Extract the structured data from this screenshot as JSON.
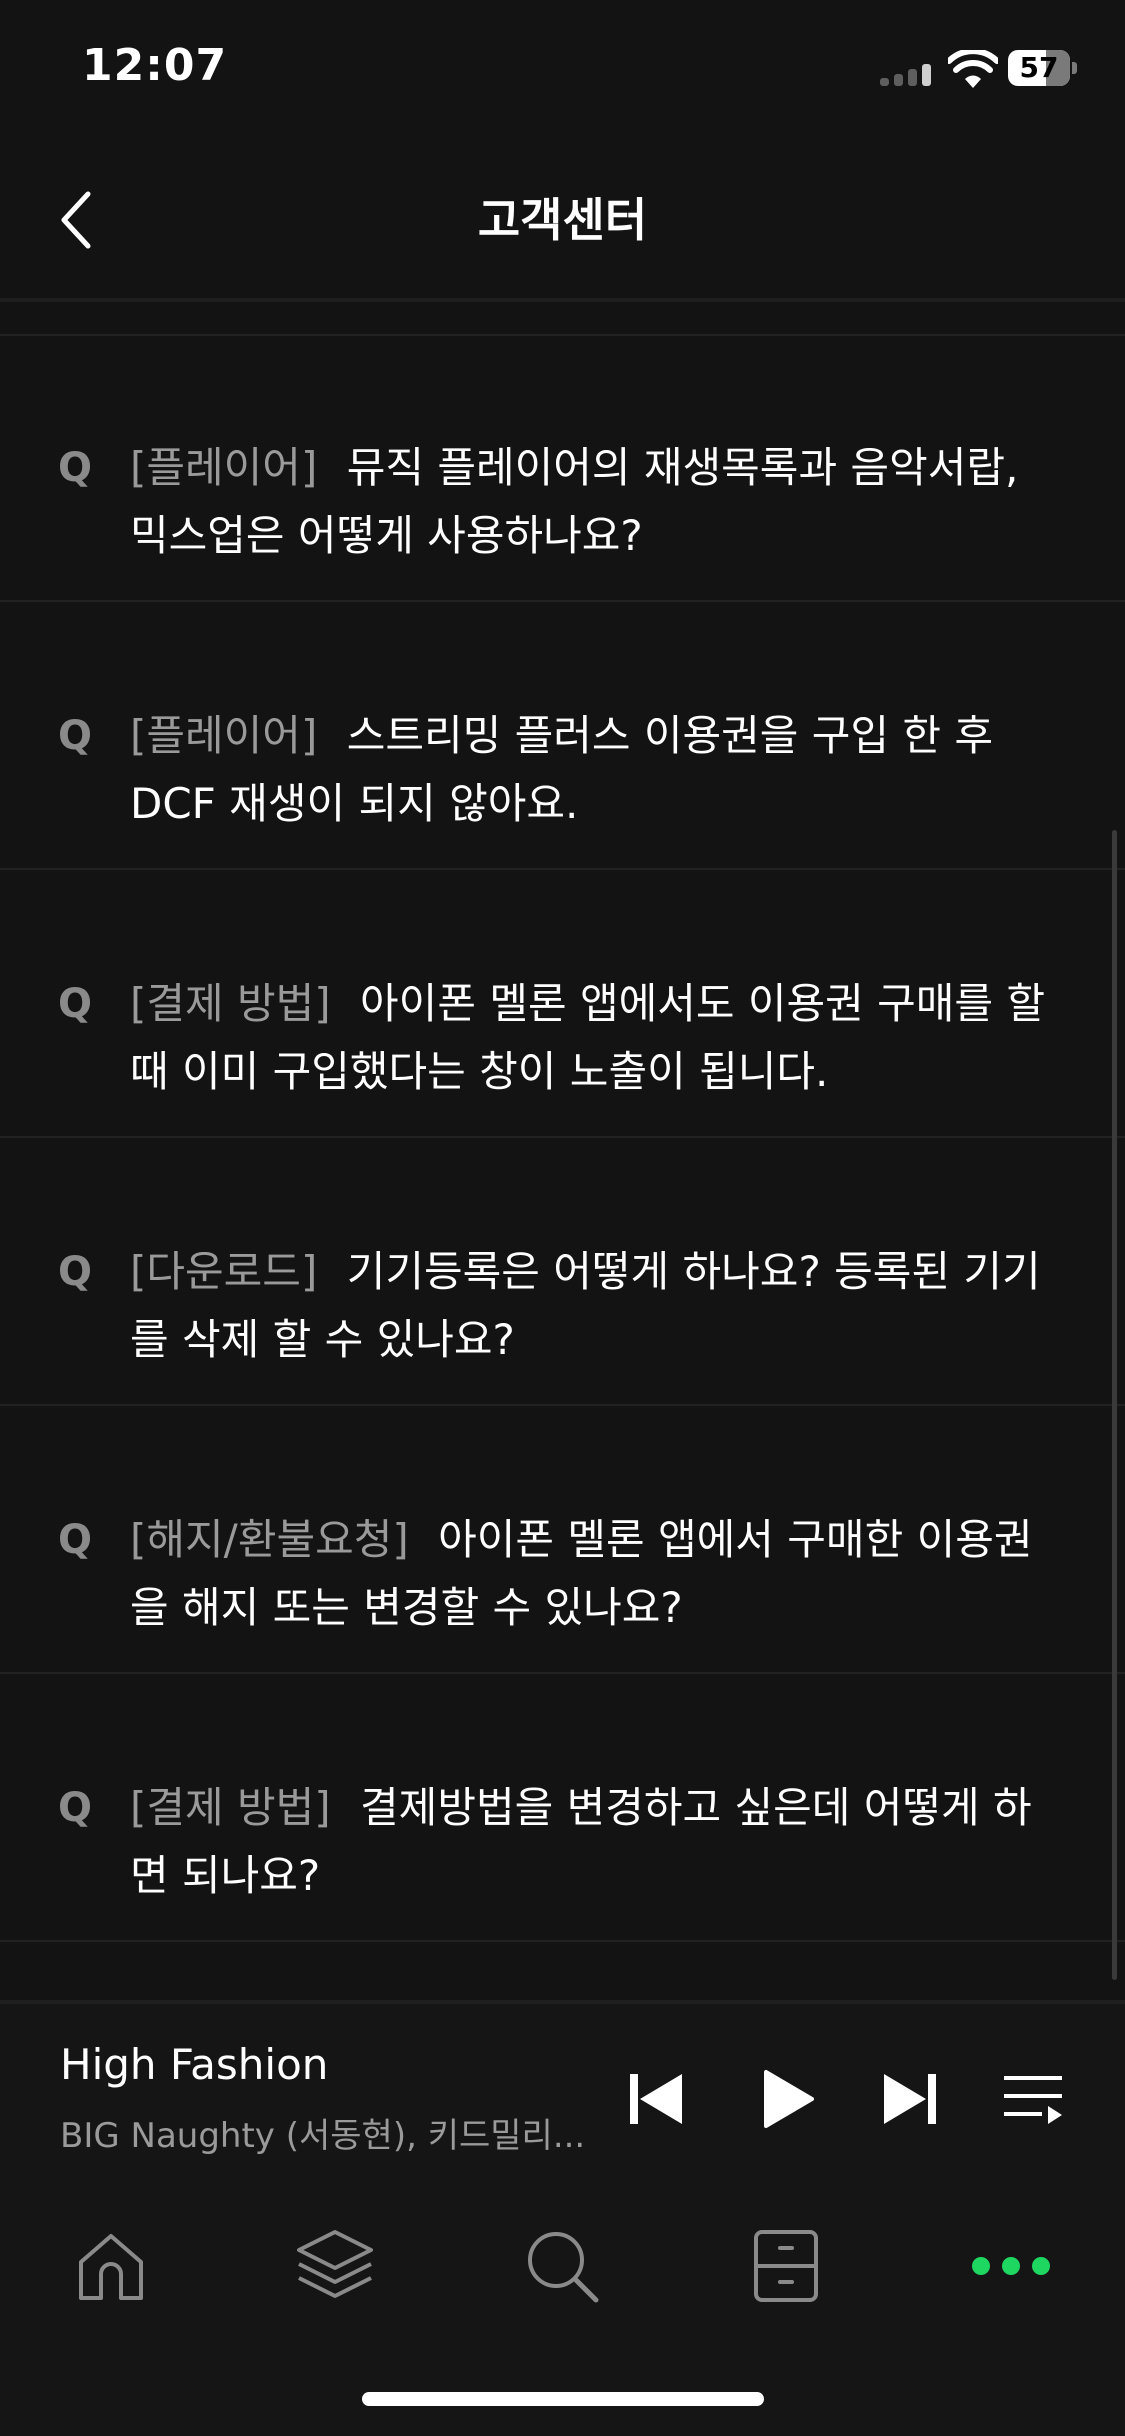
{
  "status_bar": {
    "time": "12:07",
    "battery": "57"
  },
  "header": {
    "title": "고객센터"
  },
  "faq": {
    "q_label": "Q",
    "items": [
      {
        "category": "[플레이어]",
        "question": "뮤직 플레이어의 재생목록과 음악서랍, 믹스업은 어떻게 사용하나요?"
      },
      {
        "category": "[플레이어]",
        "question": "스트리밍 플러스 이용권을 구입 한 후 DCF 재생이 되지 않아요."
      },
      {
        "category": "[결제 방법]",
        "question": "아이폰 멜론 앱에서도 이용권 구매를 할 때 이미 구입했다는 창이 노출이 됩니다."
      },
      {
        "category": "[다운로드]",
        "question": "기기등록은 어떻게 하나요? 등록된 기기를 삭제 할 수 있나요?"
      },
      {
        "category": "[해지/환불요청]",
        "question": "아이폰 멜론 앱에서 구매한 이용권을 해지 또는 변경할 수 있나요?"
      },
      {
        "category": "[결제 방법]",
        "question": "결제방법을 변경하고 싶은데 어떻게 하면 되나요?"
      }
    ]
  },
  "player": {
    "title": "High Fashion",
    "artist": "BIG Naughty (서동현), 키드밀리..."
  },
  "colors": {
    "accent": "#1ed760",
    "background": "#131313"
  }
}
